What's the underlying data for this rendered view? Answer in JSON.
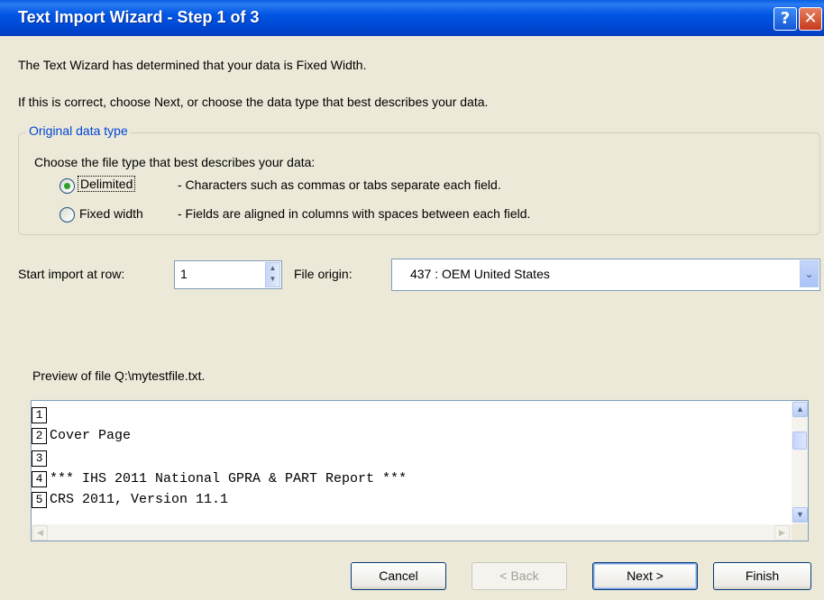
{
  "window": {
    "title": "Text Import Wizard - Step 1 of 3",
    "help_glyph": "?",
    "close_glyph": "✕"
  },
  "intro": {
    "line1": "The Text Wizard has determined that your data is Fixed Width.",
    "line2": "If this is correct, choose Next, or choose the data type that best describes your data."
  },
  "original_data_type": {
    "legend": "Original data type",
    "prompt": "Choose the file type that best describes your data:",
    "options": [
      {
        "label": "Delimited",
        "desc": "- Characters such as commas or tabs separate each field.",
        "selected": true
      },
      {
        "label": "Fixed width",
        "desc": "- Fields are aligned in columns with spaces between each field.",
        "selected": false
      }
    ]
  },
  "start_row": {
    "label": "Start import at row:",
    "value": "1"
  },
  "file_origin": {
    "label": "File origin:",
    "value": "437 : OEM United States"
  },
  "preview": {
    "label": "Preview of file Q:\\mytestfile.txt.",
    "rows": [
      {
        "num": "1",
        "text": ""
      },
      {
        "num": "2",
        "text": "Cover Page"
      },
      {
        "num": "3",
        "text": ""
      },
      {
        "num": "4",
        "text": "*** IHS 2011 National GPRA & PART Report ***"
      },
      {
        "num": "5",
        "text": "CRS 2011, Version 11.1"
      }
    ]
  },
  "buttons": {
    "cancel": "Cancel",
    "back": "< Back",
    "next": "Next >",
    "finish": "Finish"
  },
  "colors": {
    "titlebar": "#0055e3",
    "dialog_bg": "#ece9d8",
    "legend_text": "#0046d5",
    "radio_selected": "#2ba02b"
  }
}
